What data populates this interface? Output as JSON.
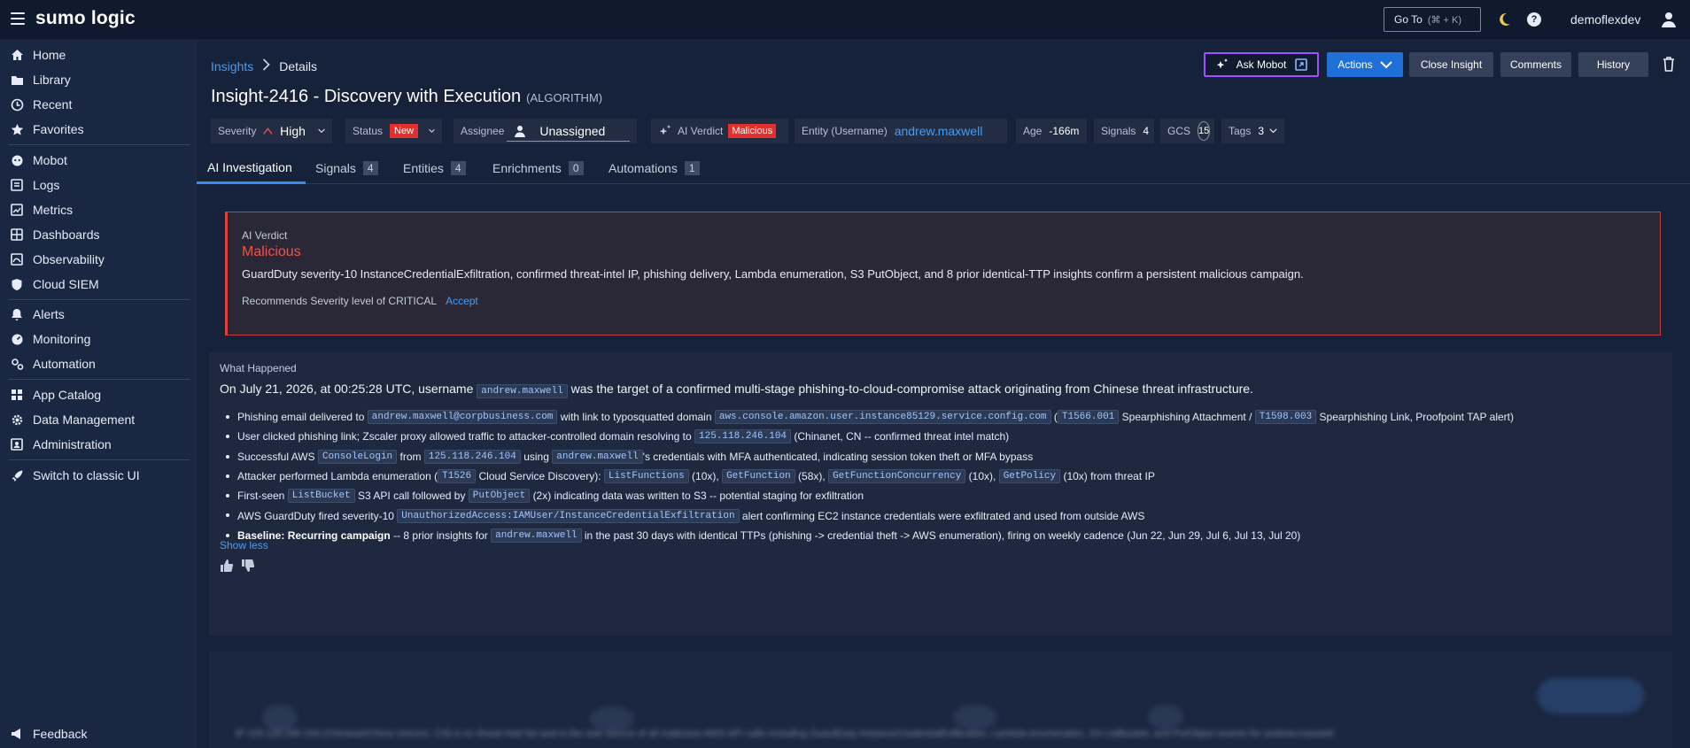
{
  "app": {
    "logo": "sumo logic",
    "goto_label": "Go To",
    "goto_shortcut": "(⌘ + K)",
    "username": "demoflexdev"
  },
  "sidebar": {
    "items": [
      {
        "label": "Home",
        "icon": "home-icon"
      },
      {
        "label": "Library",
        "icon": "folder-icon"
      },
      {
        "label": "Recent",
        "icon": "clock-icon"
      },
      {
        "label": "Favorites",
        "icon": "star-icon"
      },
      {
        "label": "Mobot",
        "icon": "robot-icon"
      },
      {
        "label": "Logs",
        "icon": "logs-icon"
      },
      {
        "label": "Metrics",
        "icon": "metrics-icon"
      },
      {
        "label": "Dashboards",
        "icon": "dashboard-icon"
      },
      {
        "label": "Observability",
        "icon": "observability-icon"
      },
      {
        "label": "Cloud SIEM",
        "icon": "shield-icon"
      },
      {
        "label": "Alerts",
        "icon": "bell-icon"
      },
      {
        "label": "Monitoring",
        "icon": "monitoring-icon"
      },
      {
        "label": "Automation",
        "icon": "automation-icon"
      },
      {
        "label": "App Catalog",
        "icon": "grid-icon"
      },
      {
        "label": "Data Management",
        "icon": "gear-icon"
      },
      {
        "label": "Administration",
        "icon": "admin-icon"
      },
      {
        "label": "Switch to classic UI",
        "icon": "rocket-icon"
      }
    ],
    "feedback": "Feedback"
  },
  "breadcrumb": {
    "root": "Insights",
    "current": "Details"
  },
  "insight": {
    "title": "Insight-2416 - Discovery with Execution",
    "tag": "(ALGORITHM)"
  },
  "toolbar": {
    "ask_mobot": "Ask Mobot",
    "actions": "Actions",
    "close_insight": "Close Insight",
    "comments": "Comments",
    "history": "History"
  },
  "fields": {
    "severity_label": "Severity",
    "severity_value": "High",
    "status_label": "Status",
    "status_value": "New",
    "assignee_label": "Assignee",
    "assignee_value": "Unassigned",
    "ai_verdict_label": "AI Verdict",
    "ai_verdict_value": "Malicious",
    "entity_label": "Entity (Username)",
    "entity_value": "andrew.maxwell",
    "age_label": "Age",
    "age_value": "-166m",
    "signals_label": "Signals",
    "signals_value": "4",
    "gcs_label": "GCS",
    "gcs_value": "15",
    "tags_label": "Tags",
    "tags_value": "3"
  },
  "tabs": [
    {
      "label": "AI Investigation",
      "count": null
    },
    {
      "label": "Signals",
      "count": "4"
    },
    {
      "label": "Entities",
      "count": "4"
    },
    {
      "label": "Enrichments",
      "count": "0"
    },
    {
      "label": "Automations",
      "count": "1"
    }
  ],
  "verdict": {
    "label": "AI Verdict",
    "value": "Malicious",
    "summary": "GuardDuty severity-10 InstanceCredentialExfiltration, confirmed threat-intel IP, phishing delivery, Lambda enumeration, S3 PutObject, and 8 prior identical-TTP insights confirm a persistent malicious campaign.",
    "recommendation": "Recommends Severity level of CRITICAL",
    "accept": "Accept"
  },
  "what_happened": {
    "header": "What Happened",
    "intro_pre": "On July 21, 2026, at 00:25:28 UTC, username",
    "intro_code": "andrew.maxwell",
    "intro_post": "was the target of a confirmed multi-stage phishing-to-cloud-compromise attack originating from Chinese threat infrastructure.",
    "b1": {
      "t1": "Phishing email delivered to",
      "c1": "andrew.maxwell@corpbusiness.com",
      "t2": "with link to typosquatted domain",
      "c2": "aws.console.amazon.user.instance85129.service.config.com",
      "t3": "(",
      "c3": "T1566.001",
      "t4": "Spearphishing Attachment /",
      "c4": "T1598.003",
      "t5": "Spearphishing Link, Proofpoint TAP alert)"
    },
    "b2": {
      "t1": "User clicked phishing link; Zscaler proxy allowed traffic to attacker-controlled domain resolving to",
      "c1": "125.118.246.104",
      "t2": "(Chinanet, CN -- confirmed threat intel match)"
    },
    "b3": {
      "t1": "Successful AWS",
      "c1": "ConsoleLogin",
      "t2": "from",
      "c2": "125.118.246.104",
      "t3": "using",
      "c3": "andrew.maxwell",
      "t4": "'s credentials with MFA authenticated, indicating session token theft or MFA bypass"
    },
    "b4": {
      "t1": "Attacker performed Lambda enumeration (",
      "c1": "T1526",
      "t2": "Cloud Service Discovery):",
      "c2": "ListFunctions",
      "t3": "(10x),",
      "c3": "GetFunction",
      "t4": "(58x),",
      "c4": "GetFunctionConcurrency",
      "t5": "(10x),",
      "c5": "GetPolicy",
      "t6": "(10x) from threat IP"
    },
    "b5": {
      "t1": "First-seen",
      "c1": "ListBucket",
      "t2": "S3 API call followed by",
      "c2": "PutObject",
      "t3": "(2x) indicating data was written to S3 -- potential staging for exfiltration"
    },
    "b6": {
      "t1": "AWS GuardDuty fired severity-10",
      "c1": "UnauthorizedAccess:IAMUser/InstanceCredentialExfiltration",
      "t2": "alert confirming EC2 instance credentials were exfiltrated and used from outside AWS"
    },
    "b7": {
      "bold": "Baseline: Recurring campaign",
      "t1": "-- 8 prior insights for",
      "c1": "andrew.maxwell",
      "t2": "in the past 30 days with identical TTPs (phishing -> credential theft -> AWS enumeration), firing on weekly cadence (Jun 22, Jun 29, Jul 6, Jul 13, Jul 20)"
    },
    "show_less": "Show less"
  },
  "blurred_text": "IP 125.118.246.106 (Chinanet/China Unicom, CN) is on threat intel list and is the sole source of all malicious AWS API calls including GuardDuty InstanceCredentialExfiltration, Lambda enumeration, S3 ListBucket, and PutObject events for andrew.maxwell"
}
